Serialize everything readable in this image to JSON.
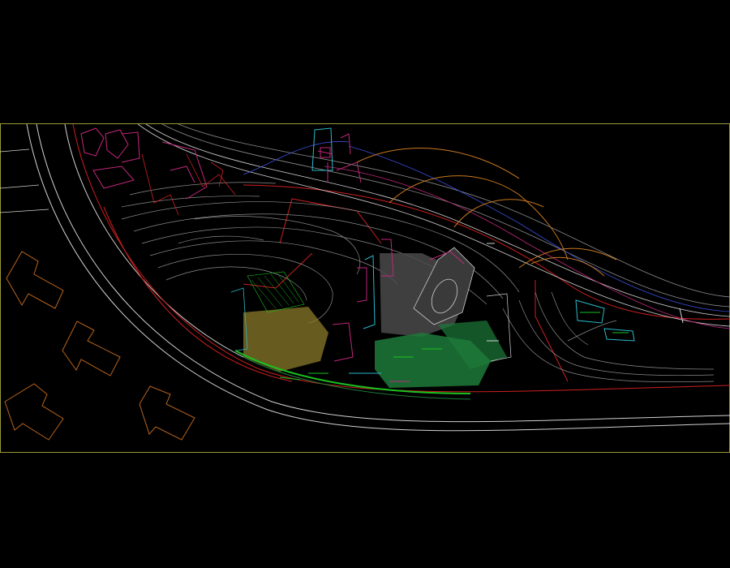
{
  "drawing": {
    "background": "#000000",
    "border_color": "#9a9a3a",
    "colors": {
      "road": "#d0d0d0",
      "boundary": "#cc1f1f",
      "contour": "#8a8a8a",
      "path_orange": "#c8781e",
      "path_blue": "#3a4fd8",
      "magenta": "#c0287a",
      "cyan": "#2ab8c8",
      "plaza_green": "#1e7a3a",
      "bright_green": "#19c21f",
      "olive_fill": "#8a7a2a",
      "gray_fill": "#4a4a4a",
      "building_outline": "#b8641e"
    },
    "layers": [
      {
        "name": "roads",
        "color_key": "road"
      },
      {
        "name": "site-boundary",
        "color_key": "boundary"
      },
      {
        "name": "contours",
        "color_key": "contour"
      },
      {
        "name": "paths",
        "color_key": "path_orange"
      },
      {
        "name": "water-edge",
        "color_key": "path_blue"
      },
      {
        "name": "plaza",
        "color_key": "plaza_green"
      },
      {
        "name": "buildings",
        "color_key": "building_outline"
      }
    ]
  }
}
